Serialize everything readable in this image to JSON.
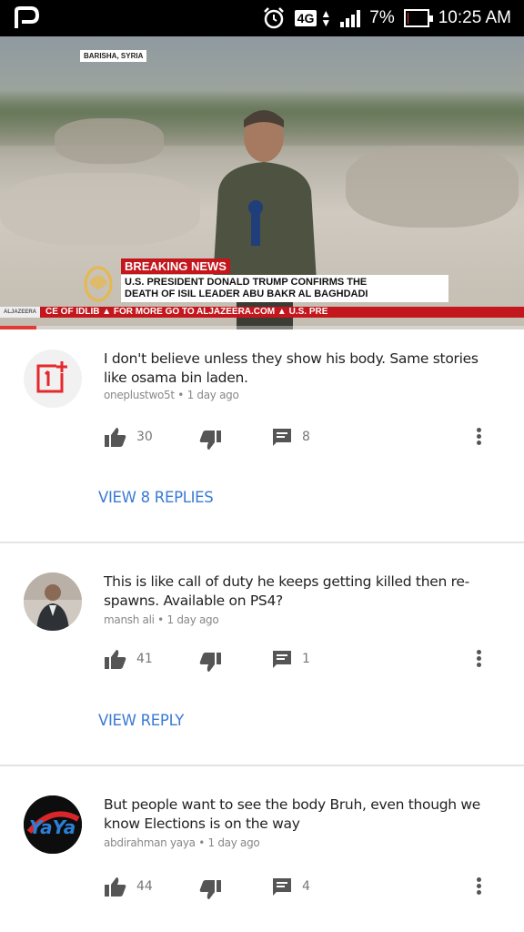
{
  "status_bar": {
    "network": "4G",
    "battery": "7%",
    "battery_level": 0.07,
    "time": "10:25 AM"
  },
  "video": {
    "location": "BARISHA, SYRIA",
    "breaking": "BREAKING NEWS",
    "headline_line1": "U.S. PRESIDENT DONALD TRUMP CONFIRMS THE",
    "headline_line2": "DEATH OF ISIL LEADER ABU BAKR AL BAGHDADI",
    "ticker_logo": "ALJAZEERA",
    "ticker": "CE OF IDLIB   ▲   FOR MORE GO TO ALJAZEERA.COM   ▲   U.S. PRE",
    "progress": 0.07
  },
  "comments": [
    {
      "text": "I don't believe unless they show his body. Same stories like osama bin laden.",
      "author": "oneplustwo5t",
      "time": "1 day ago",
      "likes": "30",
      "replies_count": "8",
      "view_replies": "VIEW 8 REPLIES"
    },
    {
      "text": "This is like call of duty he keeps getting killed then re- spawns. Available on PS4?",
      "author": "mansh ali",
      "time": "1 day ago",
      "likes": "41",
      "replies_count": "1",
      "view_replies": "VIEW REPLY"
    },
    {
      "text": "But people want to see the body Bruh, even though we know Elections is on the way",
      "author": "abdirahman yaya",
      "time": "1 day ago",
      "likes": "44",
      "replies_count": "4"
    }
  ],
  "colors": {
    "link": "#3a7bd5",
    "breaking_red": "#c4171d",
    "oneplus_red": "#e6282d"
  },
  "avatar_text": {
    "c3": "YaYa"
  }
}
